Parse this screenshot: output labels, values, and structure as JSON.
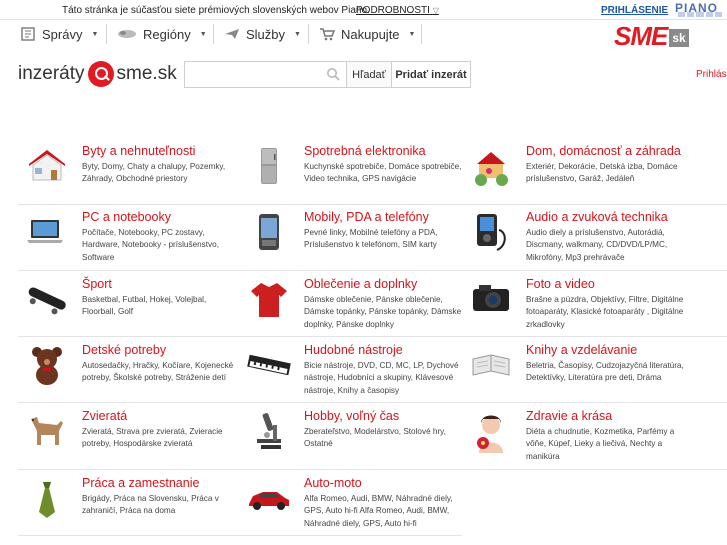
{
  "piano": {
    "message": "Táto stránka je súčasťou siete prémiových slovenských webov Piano.",
    "more": "PODROBNOSTI",
    "login": "PRIHLÁSENIE",
    "logo": "PIANO"
  },
  "nav": {
    "items": [
      {
        "label": "Správy",
        "icon": "news-icon"
      },
      {
        "label": "Regióny",
        "icon": "region-icon"
      },
      {
        "label": "Služby",
        "icon": "plane-icon"
      },
      {
        "label": "Nakupujte",
        "icon": "cart-icon"
      }
    ],
    "logo_main": "SME",
    "logo_suffix": "sk"
  },
  "brand": {
    "left": "inzeráty",
    "right": "sme.sk"
  },
  "search": {
    "placeholder": "",
    "button": "Hľadať",
    "add_button": "Pridať inzerát",
    "signin": "Prihlásenie"
  },
  "accent": "#d5141b",
  "categories": [
    {
      "title": "Byty a nehnuteľnosti",
      "desc": "Byty, Domy, Chaty a chalupy, Pozemky, Záhrady, Obchodné priestory",
      "icon": "house-icon"
    },
    {
      "title": "Spotrebná elektronika",
      "desc": "Kuchynské spotrebiče, Domáce spotrebiče, Video technika, GPS navigácie",
      "icon": "fridge-icon"
    },
    {
      "title": "Dom, domácnosť a záhrada",
      "desc": "Exteriér, Dekorácie, Detská izba, Domáce príslušenstvo, Garáž, Jedáleň",
      "icon": "home-garden-icon"
    },
    {
      "title": "PC a notebooky",
      "desc": "Počítače, Notebooky, PC zostavy, Hardware, Notebooky - príslušenstvo, Software",
      "icon": "laptop-icon"
    },
    {
      "title": "Mobily, PDA a telefóny",
      "desc": "Pevné linky, Mobilné telefóny a PDA, Príslušenstvo k telefónom, SIM karty",
      "icon": "phone-icon"
    },
    {
      "title": "Audio a zvuková technika",
      "desc": "Audio diely a príslušenstvo, Autorádiá, Discmany, walkmany, CD/DVD/LP/MC, Mikrofóny, Mp3 prehrávače",
      "icon": "mp3-player-icon"
    },
    {
      "title": "Šport",
      "desc": "Basketbal, Futbal, Hokej, Volejbal, Floorball, Golf",
      "icon": "skateboard-icon"
    },
    {
      "title": "Oblečenie a doplnky",
      "desc": "Dámske oblečenie, Pánske oblečenie, Dámske topánky, Pánske topánky, Dámske doplnky, Pánske doplnky",
      "icon": "shirt-icon"
    },
    {
      "title": "Foto a video",
      "desc": "Brašne a púzdra, Objektívy, Filtre, Digitálne fotoaparáty, Klasické fotoaparáty , Digitálne zrkadlovky",
      "icon": "camera-icon"
    },
    {
      "title": "Detské potreby",
      "desc": "Autosedačky, Hračky, Kočíare, Kojenecké potreby, Školské potreby, Stráženie detí",
      "icon": "teddy-bear-icon"
    },
    {
      "title": "Hudobné nástroje",
      "desc": "Bicie nástroje, DVD, CD, MC, LP, Dychové nástroje, Hudobníci a skupiny, Klávesové nástroje, Knihy a časopisy",
      "icon": "keyboard-instrument-icon"
    },
    {
      "title": "Knihy a vzdelávanie",
      "desc": "Beletria, Časopisy, Cudzojazyčná literatúra, Detektívky, Literatúra pre deti, Dráma",
      "icon": "book-icon"
    },
    {
      "title": "Zvieratá",
      "desc": "Zvieratá, Strava pre zvieratá, Zvieracie potreby, Hospodárske zvieratá",
      "icon": "dog-icon"
    },
    {
      "title": "Hobby, voľný čas",
      "desc": "Zberateľstvo, Modelárstvo, Stolové hry, Ostatné",
      "icon": "microscope-icon"
    },
    {
      "title": "Zdravie a krása",
      "desc": "Diéta a chudnutie, Kozmetika, Parfémy a vôňe, Kúpeľ, Lieky a liečivá, Nechty a manikúra",
      "icon": "woman-flower-icon"
    },
    {
      "title": "Práca a zamestnanie",
      "desc": "Brigády, Práca na Slovensku, Práca v zahraničí, Práca na doma",
      "icon": "tie-icon"
    },
    {
      "title": "Auto-moto",
      "desc": "Alfa Romeo, Audi, BMW, Náhradné diely, GPS, Auto hi-fi Alfa Romeo, Audi, BMW, Náhradné diely, GPS, Auto hi-fi",
      "icon": "car-icon"
    }
  ]
}
